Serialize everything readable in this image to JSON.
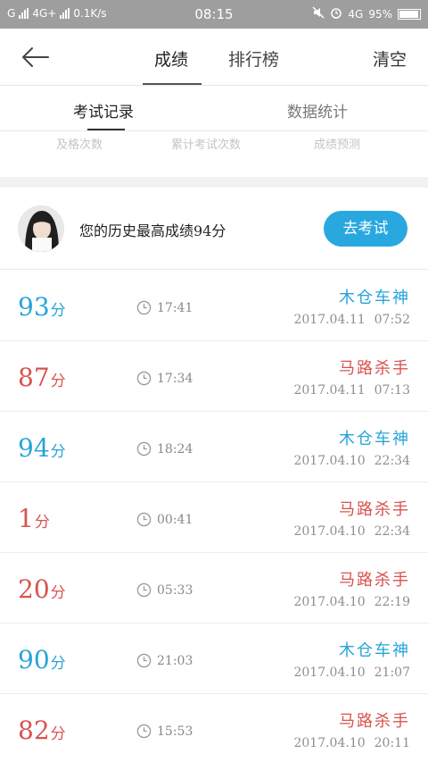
{
  "status_bar": {
    "carrier": "G",
    "network": "4G+",
    "speed": "0.1K/s",
    "time": "08:15",
    "network_right": "4G",
    "battery": "95%"
  },
  "header": {
    "tab_score": "成绩",
    "tab_rank": "排行榜",
    "clear_label": "清空"
  },
  "subtabs": {
    "records": "考试记录",
    "stats": "数据统计"
  },
  "stats_labels": [
    "及格次数",
    "累计考试次数",
    "成绩预测"
  ],
  "best": {
    "text": "您的历史最高成绩94分",
    "button": "去考试"
  },
  "colors": {
    "accent": "#29a8e0",
    "pass": "#27a4d8",
    "fail": "#d9534f"
  },
  "records": [
    {
      "score": "93",
      "unit": "分",
      "duration": "17:41",
      "nickname": "木仓车神",
      "date": "2017.04.11",
      "time": "07:52",
      "status": "pass"
    },
    {
      "score": "87",
      "unit": "分",
      "duration": "17:34",
      "nickname": "马路杀手",
      "date": "2017.04.11",
      "time": "07:13",
      "status": "fail"
    },
    {
      "score": "94",
      "unit": "分",
      "duration": "18:24",
      "nickname": "木仓车神",
      "date": "2017.04.10",
      "time": "22:34",
      "status": "pass"
    },
    {
      "score": "1",
      "unit": "分",
      "duration": "00:41",
      "nickname": "马路杀手",
      "date": "2017.04.10",
      "time": "22:34",
      "status": "fail"
    },
    {
      "score": "20",
      "unit": "分",
      "duration": "05:33",
      "nickname": "马路杀手",
      "date": "2017.04.10",
      "time": "22:19",
      "status": "fail"
    },
    {
      "score": "90",
      "unit": "分",
      "duration": "21:03",
      "nickname": "木仓车神",
      "date": "2017.04.10",
      "time": "21:07",
      "status": "pass"
    },
    {
      "score": "82",
      "unit": "分",
      "duration": "15:53",
      "nickname": "马路杀手",
      "date": "2017.04.10",
      "time": "20:11",
      "status": "fail"
    }
  ]
}
